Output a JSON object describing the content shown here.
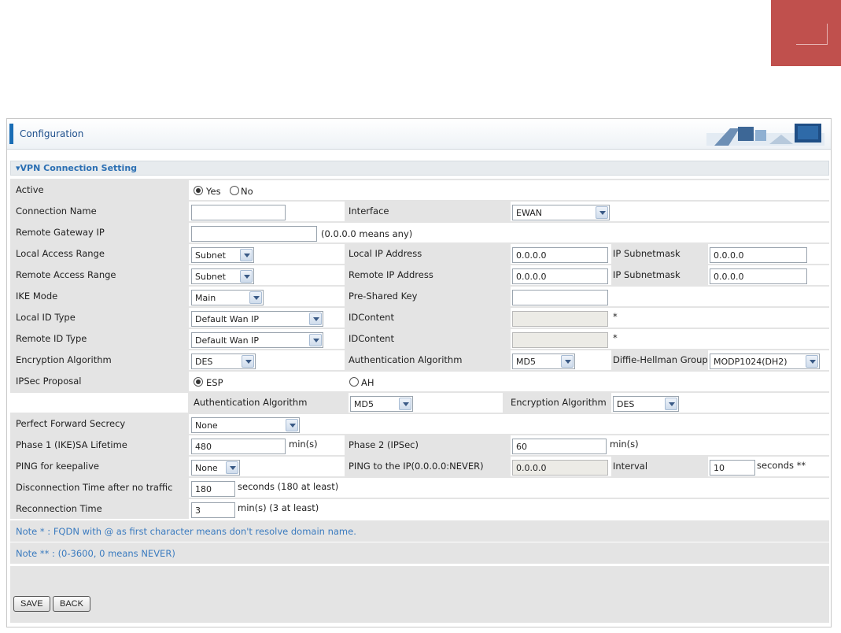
{
  "header": {
    "title": "Configuration"
  },
  "section": {
    "title": "▾VPN Connection Setting"
  },
  "rows": {
    "active": {
      "label": "Active",
      "yes": "Yes",
      "no": "No",
      "selected": "Yes"
    },
    "connection_name": {
      "label": "Connection Name",
      "value": "",
      "interface_label": "Interface",
      "interface_value": "EWAN"
    },
    "remote_gateway": {
      "label": "Remote Gateway IP",
      "value": "",
      "hint": "(0.0.0.0 means any)"
    },
    "local_access": {
      "label": "Local Access Range",
      "range_value": "Subnet",
      "ip_label": "Local IP Address",
      "ip_value": "0.0.0.0",
      "mask_label": "IP Subnetmask",
      "mask_value": "0.0.0.0"
    },
    "remote_access": {
      "label": "Remote Access Range",
      "range_value": "Subnet",
      "ip_label": "Remote IP Address",
      "ip_value": "0.0.0.0",
      "mask_label": "IP Subnetmask",
      "mask_value": "0.0.0.0"
    },
    "ike_mode": {
      "label": "IKE Mode",
      "value": "Main",
      "psk_label": "Pre-Shared Key",
      "psk_value": ""
    },
    "local_id": {
      "label": "Local ID Type",
      "value": "Default Wan IP",
      "content_label": "IDContent",
      "content_value": "",
      "star": "*"
    },
    "remote_id": {
      "label": "Remote ID Type",
      "value": "Default Wan IP",
      "content_label": "IDContent",
      "content_value": "",
      "star": "*"
    },
    "encryption": {
      "label": "Encryption Algorithm",
      "value": "DES",
      "auth_label": "Authentication Algorithm",
      "auth_value": "MD5",
      "dh_label": "Diffie-Hellman Group",
      "dh_value": "MODP1024(DH2)"
    },
    "ipsec": {
      "label": "IPSec Proposal",
      "esp": "ESP",
      "ah": "AH",
      "selected": "ESP"
    },
    "ipsec_sub": {
      "auth_label": "Authentication Algorithm",
      "auth_value": "MD5",
      "enc_label": "Encryption Algorithm",
      "enc_value": "DES"
    },
    "pfs": {
      "label": "Perfect Forward Secrecy",
      "value": "None"
    },
    "phase1": {
      "label": "Phase 1 (IKE)SA Lifetime",
      "value": "480",
      "unit": "min(s)",
      "phase2_label": "Phase 2 (IPSec)",
      "phase2_value": "60",
      "phase2_unit": "min(s)"
    },
    "ping": {
      "label": "PING for keepalive",
      "value": "None",
      "ip_label": "PING to the IP(0.0.0.0:NEVER)",
      "ip_value": "0.0.0.0",
      "interval_label": "Interval",
      "interval_value": "10",
      "interval_unit": "seconds **"
    },
    "disconnect": {
      "label": "Disconnection Time after no traffic",
      "value": "180",
      "hint": "seconds (180 at least)"
    },
    "reconnect": {
      "label": "Reconnection Time",
      "value": "3",
      "hint": "min(s) (3 at least)"
    }
  },
  "notes": {
    "note1": "Note * : FQDN with @ as first character means don't resolve domain name.",
    "note2": "Note ** : (0-3600, 0 means NEVER)"
  },
  "buttons": {
    "save": "SAVE",
    "back": "BACK"
  },
  "colors": {
    "accent": "#1a6db5",
    "corner": "#c0504d",
    "row_bg": "#e4e4e4",
    "note": "#3b7bbf"
  }
}
